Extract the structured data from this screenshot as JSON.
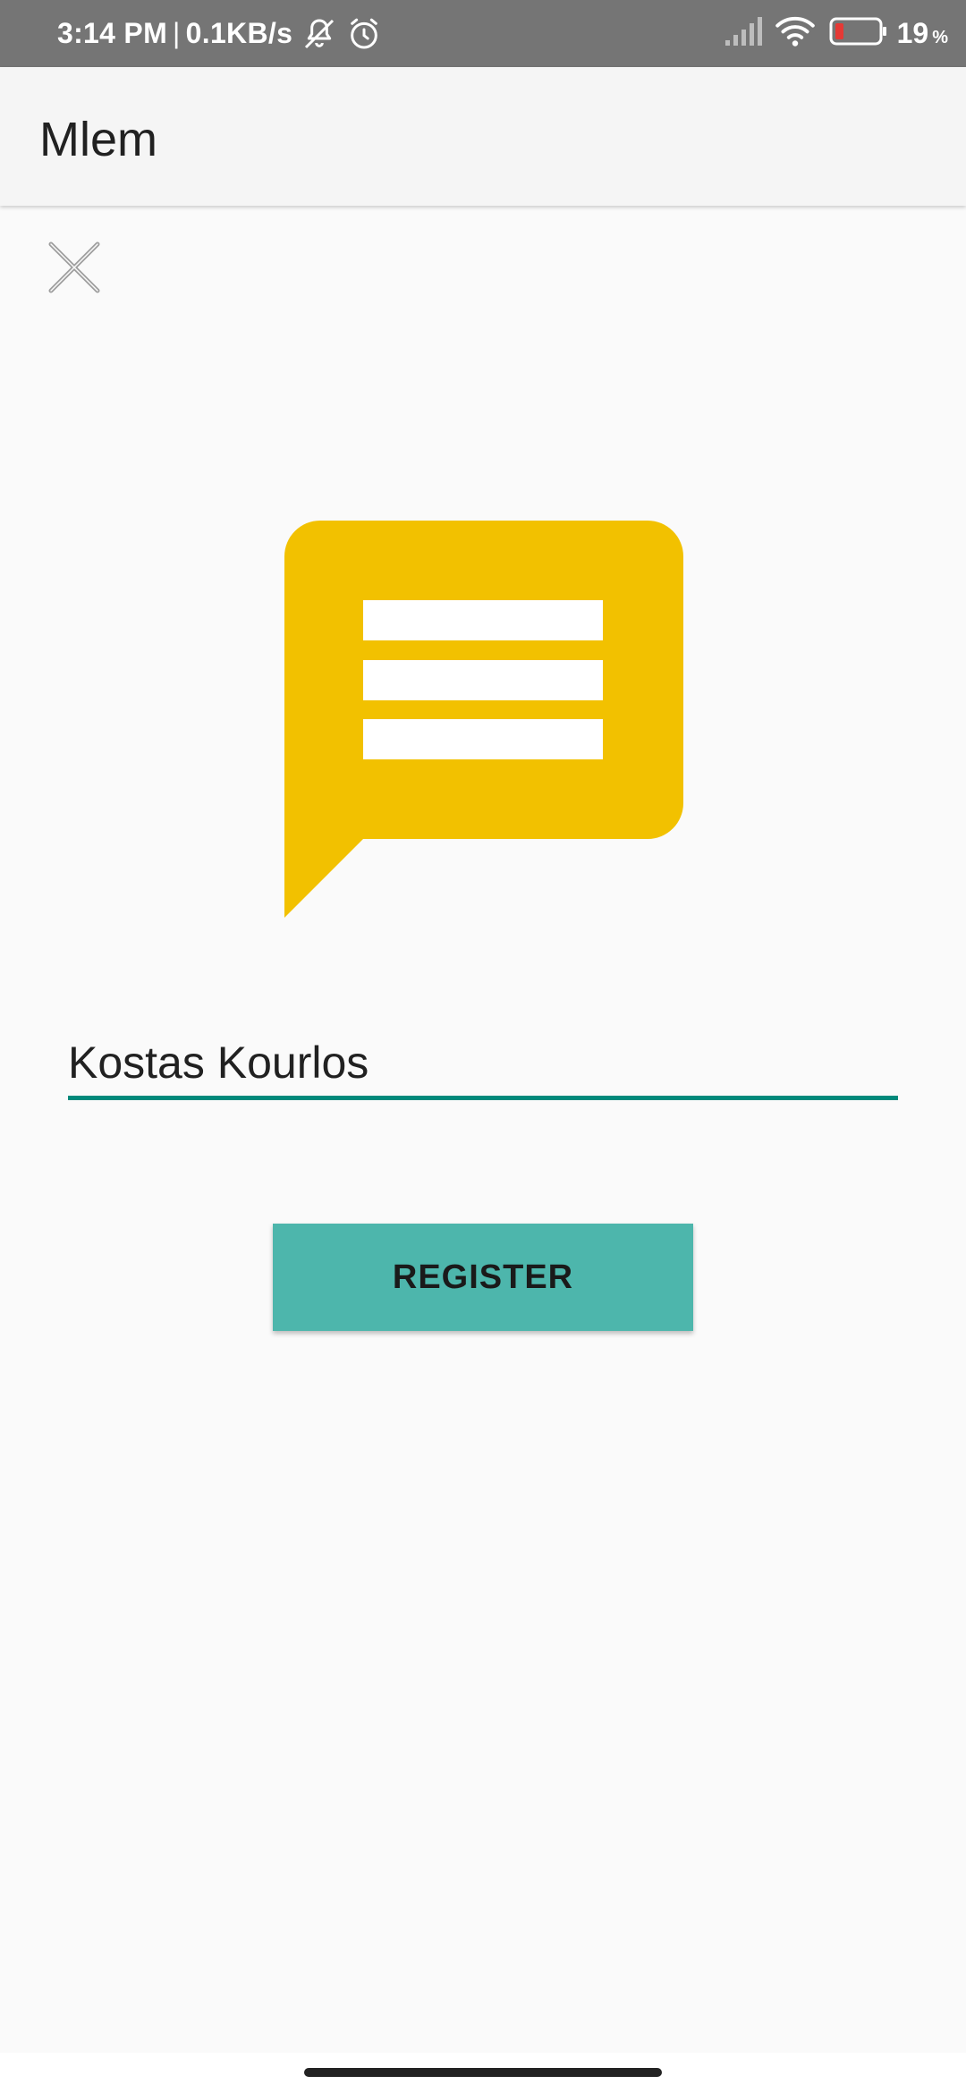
{
  "status_bar": {
    "time": "3:14 PM",
    "separator": "|",
    "net_speed": "0.1KB/s",
    "battery_level": "19",
    "battery_unit": "%",
    "icons": [
      "muted-bell-icon",
      "alarm-icon",
      "signal-icon",
      "wifi-icon",
      "battery-icon"
    ],
    "battery_color": "#e53935"
  },
  "app_bar": {
    "title": "Mlem"
  },
  "close_icon": "close-icon",
  "logo": {
    "icon": "chat-bubble-icon",
    "color": "#f2c100"
  },
  "form": {
    "name_value": "Kostas Kourlos",
    "accent": "#00897b"
  },
  "register_button": {
    "label": "REGISTER",
    "color": "#4db6ac"
  }
}
